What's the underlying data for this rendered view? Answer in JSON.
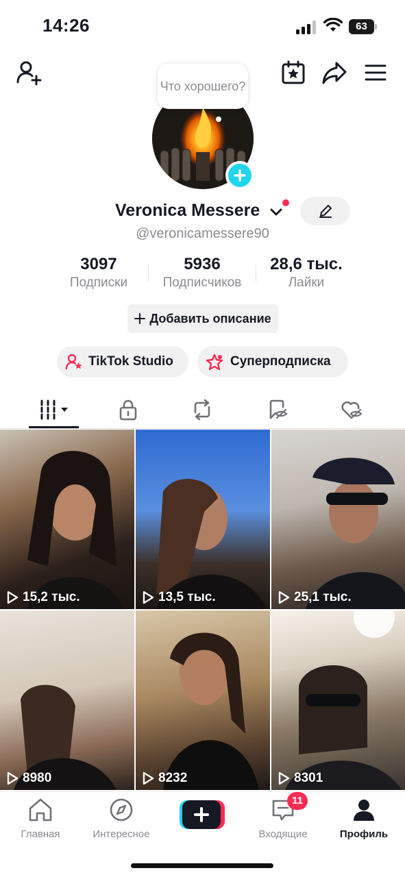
{
  "status_bar": {
    "time": "14:26",
    "battery": "63"
  },
  "top_bar": {
    "icons": [
      "add-friend-icon",
      "calendar-star-icon",
      "share-icon",
      "menu-icon"
    ]
  },
  "profile": {
    "bubble_text": "Что хорошего?",
    "display_name": "Veronica Messere",
    "username": "@veronicamessere90",
    "stats": [
      {
        "value": "3097",
        "label": "Подписки"
      },
      {
        "value": "5936",
        "label": "Подписчиков"
      },
      {
        "value": "28,6 тыс.",
        "label": "Лайки"
      }
    ],
    "bio_button": "Добавить описание",
    "pills": [
      {
        "label": "TikTok Studio"
      },
      {
        "label": "Суперподписка"
      }
    ]
  },
  "tabs": [
    "videos",
    "private",
    "reposts",
    "favorites",
    "liked"
  ],
  "videos": [
    {
      "views": "15,2 тыс."
    },
    {
      "views": "13,5 тыс."
    },
    {
      "views": "25,1 тыс."
    },
    {
      "views": "8980"
    },
    {
      "views": "8232"
    },
    {
      "views": "8301"
    }
  ],
  "bottom_nav": {
    "items": [
      {
        "label": "Главная"
      },
      {
        "label": "Интересное"
      },
      {
        "label": ""
      },
      {
        "label": "Входящие"
      },
      {
        "label": "Профиль"
      }
    ],
    "inbox_badge": "11"
  },
  "colors": {
    "accent": "#fe2c55",
    "cyan": "#20d5ec",
    "text": "#161823",
    "muted": "#8a8b91"
  }
}
